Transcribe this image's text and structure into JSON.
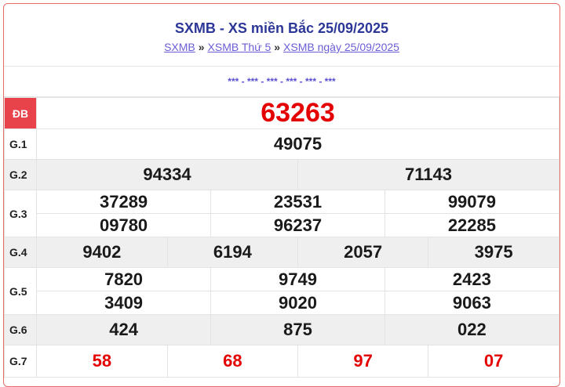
{
  "header": {
    "title": "SXMB - XS miền Bắc 25/09/2025",
    "breadcrumbs": [
      {
        "label": "SXMB"
      },
      {
        "label": "XSMB Thứ 5"
      },
      {
        "label": "XSMB ngày 25/09/2025"
      }
    ],
    "separator": "»"
  },
  "stars": "*** - *** - *** - *** - *** - ***",
  "prizes": {
    "db": {
      "label": "ĐB",
      "numbers": [
        "63263"
      ]
    },
    "g1": {
      "label": "G.1",
      "numbers": [
        "49075"
      ]
    },
    "g2": {
      "label": "G.2",
      "numbers": [
        "94334",
        "71143"
      ]
    },
    "g3": {
      "label": "G.3",
      "numbers": [
        "37289",
        "23531",
        "99079",
        "09780",
        "96237",
        "22285"
      ]
    },
    "g4": {
      "label": "G.4",
      "numbers": [
        "9402",
        "6194",
        "2057",
        "3975"
      ]
    },
    "g5": {
      "label": "G.5",
      "numbers": [
        "7820",
        "9749",
        "2423",
        "3409",
        "9020",
        "9063"
      ]
    },
    "g6": {
      "label": "G.6",
      "numbers": [
        "424",
        "875",
        "022"
      ]
    },
    "g7": {
      "label": "G.7",
      "numbers": [
        "58",
        "68",
        "97",
        "07"
      ]
    }
  },
  "colors": {
    "accent_red": "#e40000",
    "title_blue": "#2c3797",
    "link": "#6a5dd6",
    "db_label_bg": "#e8424a"
  }
}
